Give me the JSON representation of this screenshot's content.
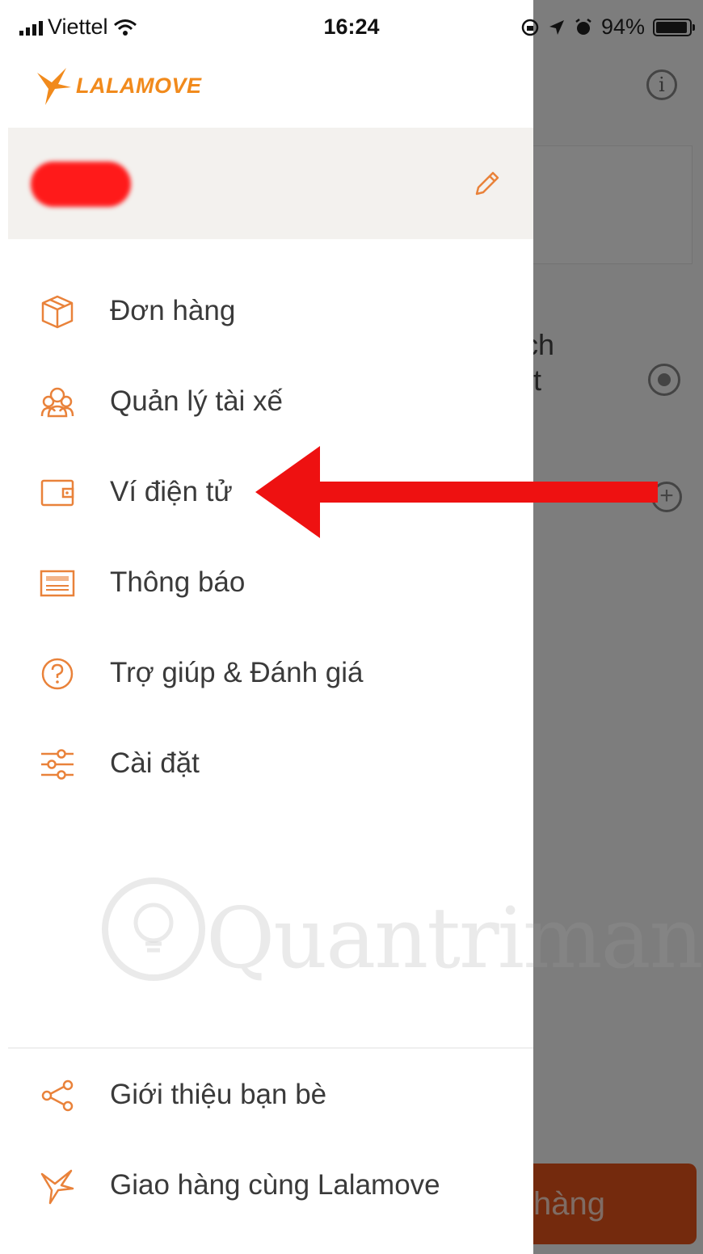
{
  "status_bar": {
    "carrier": "Viettel",
    "time": "16:24",
    "battery": "94%"
  },
  "logo": {
    "text": "LALAMOVE"
  },
  "colors": {
    "accent": "#f18a1c",
    "icon": "#e9823a",
    "annotation": "#ee1111"
  },
  "menu": {
    "items": [
      {
        "label": "Đơn hàng",
        "icon": "box-icon"
      },
      {
        "label": "Quản lý tài xế",
        "icon": "drivers-icon"
      },
      {
        "label": "Ví điện tử",
        "icon": "wallet-icon"
      },
      {
        "label": "Thông báo",
        "icon": "notifications-icon"
      },
      {
        "label": "Trợ giúp & Đánh giá",
        "icon": "help-icon"
      },
      {
        "label": "Cài đặt",
        "icon": "settings-icon"
      }
    ]
  },
  "footer_menu": {
    "items": [
      {
        "label": "Giới thiệu bạn bè",
        "icon": "share-icon"
      },
      {
        "label": "Giao hàng cùng Lalamove",
        "icon": "lalamove-bird-icon"
      }
    ]
  },
  "background": {
    "partial_text_line1": "ịch",
    "partial_text_line2": "ệt",
    "order_button_partial": "hàng"
  },
  "watermark": {
    "text": "Quantrimang"
  }
}
